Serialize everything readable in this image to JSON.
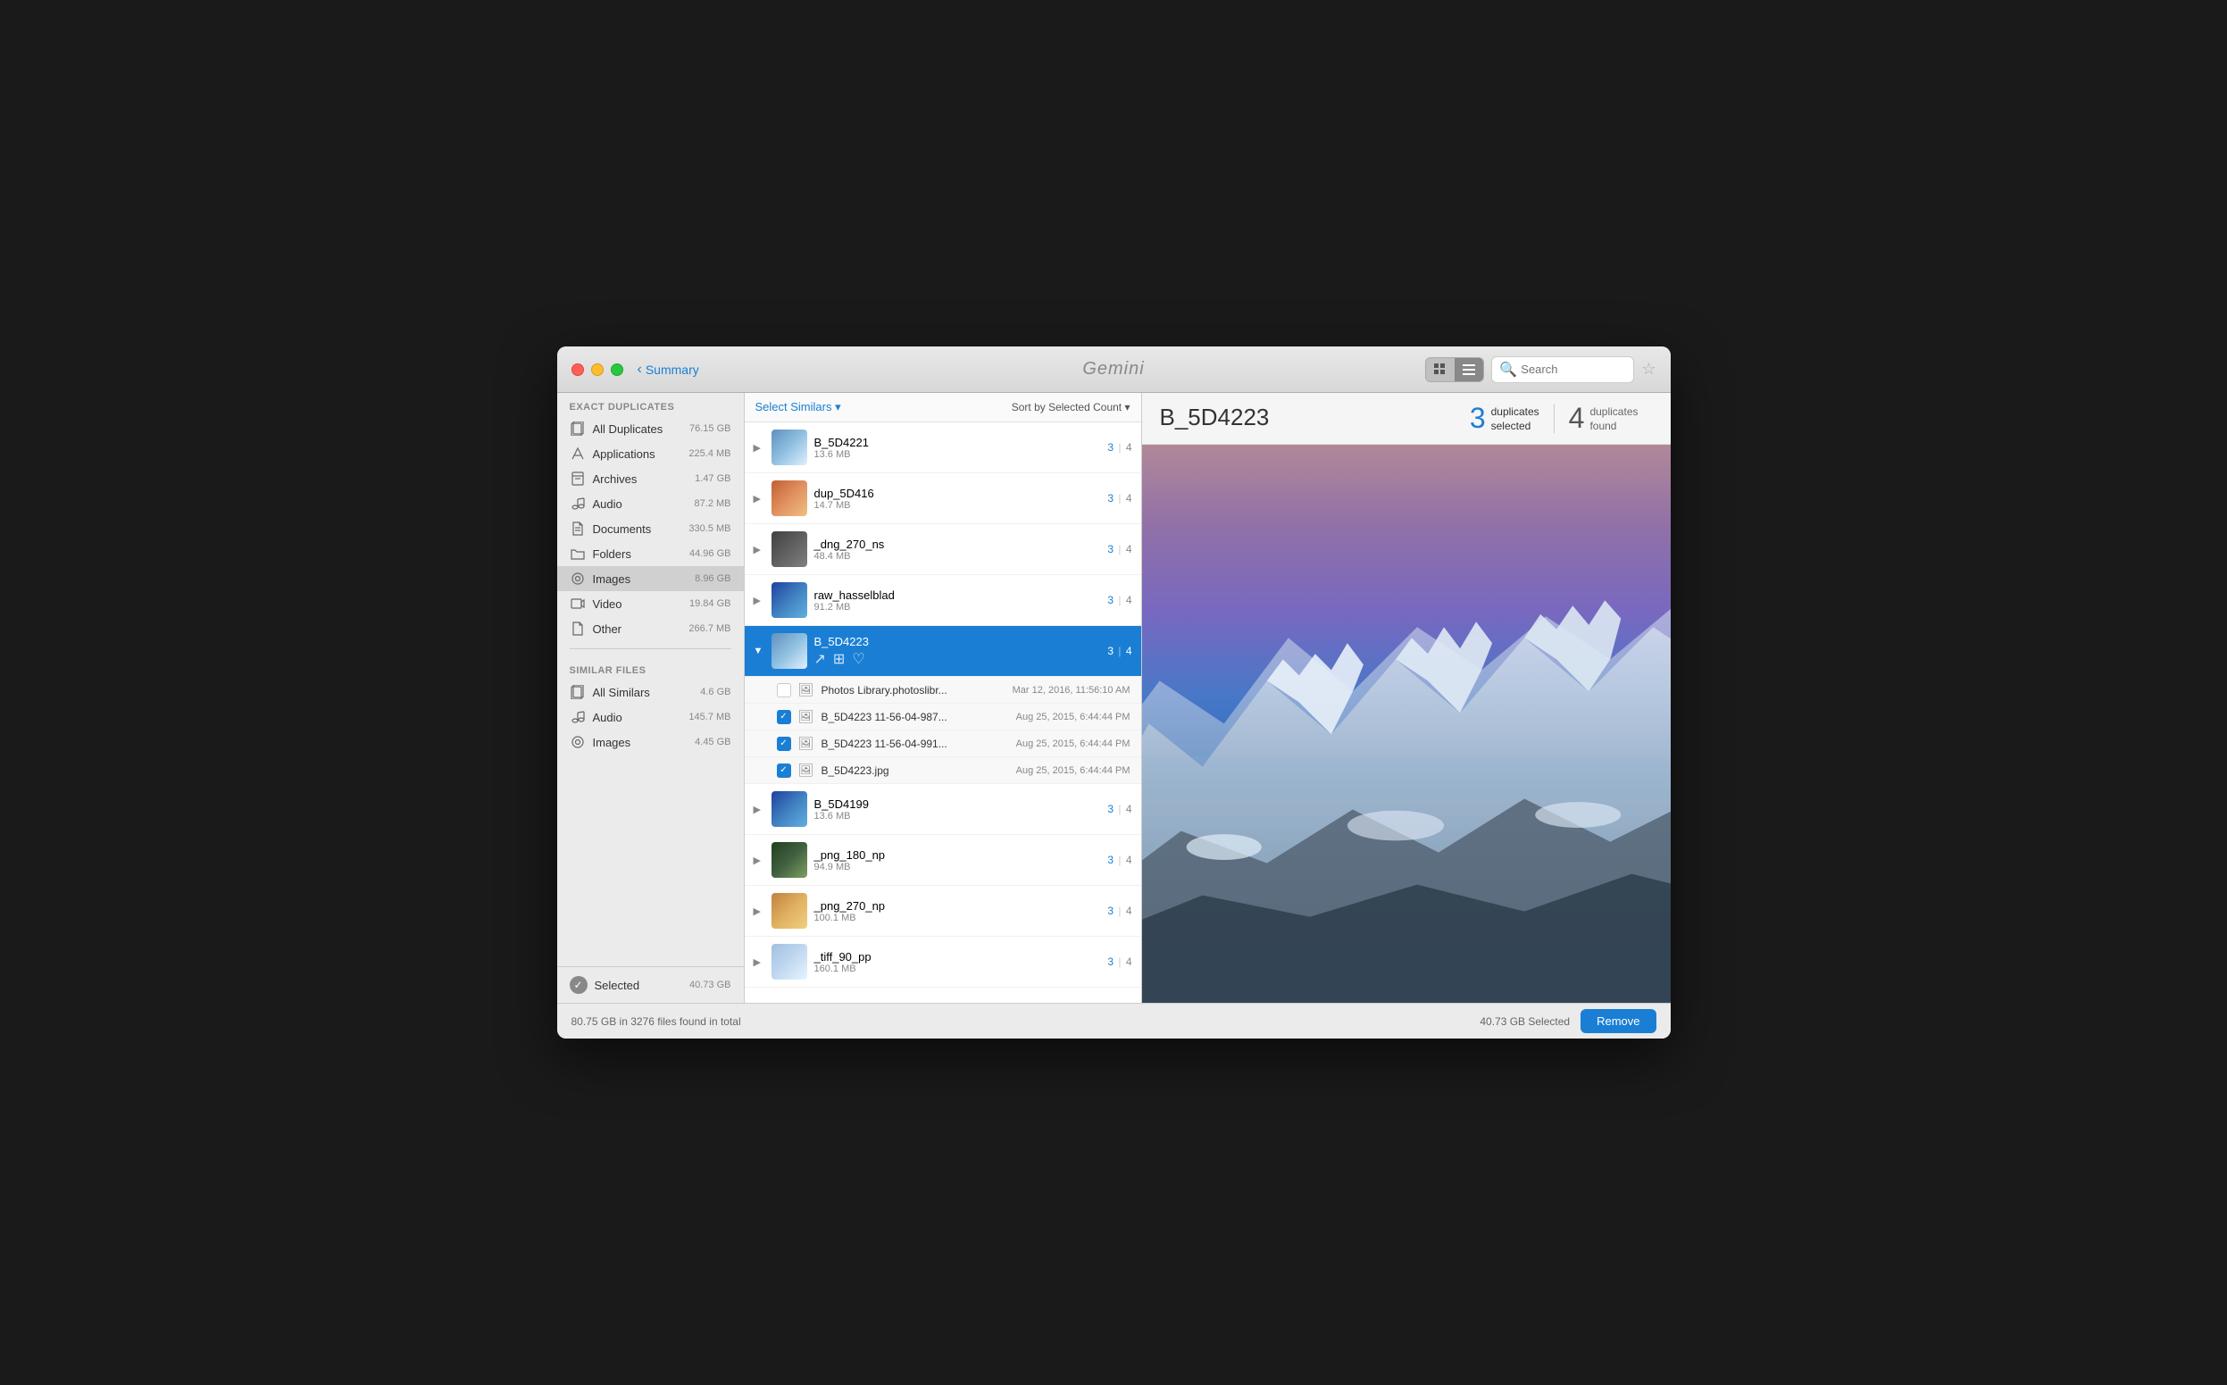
{
  "window": {
    "title": "Gemini"
  },
  "titlebar": {
    "back_label": "Summary",
    "search_placeholder": "Search",
    "view_grid_label": "⊞",
    "view_list_label": "≡"
  },
  "preview": {
    "title": "B_5D4223",
    "duplicates_selected_count": "3",
    "duplicates_selected_label": "duplicates\nselected",
    "duplicates_found_count": "4",
    "duplicates_found_label": "duplicates\nfound"
  },
  "sidebar": {
    "exact_duplicates_header": "Exact Duplicates",
    "items": [
      {
        "id": "all-duplicates",
        "label": "All Duplicates",
        "size": "76.15 GB",
        "icon": "📋"
      },
      {
        "id": "applications",
        "label": "Applications",
        "size": "225.4 MB",
        "icon": "🚀"
      },
      {
        "id": "archives",
        "label": "Archives",
        "size": "1.47 GB",
        "icon": "📦"
      },
      {
        "id": "audio",
        "label": "Audio",
        "size": "87.2 MB",
        "icon": "🎵"
      },
      {
        "id": "documents",
        "label": "Documents",
        "size": "330.5 MB",
        "icon": "📄"
      },
      {
        "id": "folders",
        "label": "Folders",
        "size": "44.96 GB",
        "icon": "📁"
      },
      {
        "id": "images",
        "label": "Images",
        "size": "8.96 GB",
        "icon": "📷"
      },
      {
        "id": "video",
        "label": "Video",
        "size": "19.84 GB",
        "icon": "🎬"
      },
      {
        "id": "other",
        "label": "Other",
        "size": "266.7 MB",
        "icon": "📎"
      }
    ],
    "similar_files_header": "Similar Files",
    "similar_items": [
      {
        "id": "all-similars",
        "label": "All Similars",
        "size": "4.6 GB",
        "icon": "📋"
      },
      {
        "id": "audio-similar",
        "label": "Audio",
        "size": "145.7 MB",
        "icon": "🎵"
      },
      {
        "id": "images-similar",
        "label": "Images",
        "size": "4.45 GB",
        "icon": "📷"
      }
    ],
    "selected_label": "Selected",
    "selected_size": "40.73 GB"
  },
  "file_list": {
    "select_similars_label": "Select Similars ▾",
    "sort_label": "Sort by Selected Count ▾",
    "groups": [
      {
        "id": "B_5D4221",
        "name": "B_5D4221",
        "size": "13.6 MB",
        "selected": "3",
        "found": "4",
        "expanded": false,
        "thumb_class": "thumb-mountains"
      },
      {
        "id": "dup_5D416",
        "name": "dup_5D416",
        "size": "14.7 MB",
        "selected": "3",
        "found": "4",
        "expanded": false,
        "thumb_class": "thumb-orange"
      },
      {
        "id": "_dng_270_ns",
        "name": "_dng_270_ns",
        "size": "48.4 MB",
        "selected": "3",
        "found": "4",
        "expanded": false,
        "thumb_class": "thumb-dark"
      },
      {
        "id": "raw_hasselblad",
        "name": "raw_hasselblad",
        "size": "91.2 MB",
        "selected": "3",
        "found": "4",
        "expanded": false,
        "thumb_class": "thumb-blue"
      },
      {
        "id": "B_5D4223",
        "name": "B_5D4223",
        "size": "",
        "selected": "3",
        "found": "4",
        "expanded": true,
        "thumb_class": "thumb-mountains",
        "sub_files": [
          {
            "id": "photos-library",
            "name": "Photos Library.photoslibr...",
            "date": "Mar 12, 2016, 11:56:10 AM",
            "checked": false,
            "icon": "🖼"
          },
          {
            "id": "b5d4223-1",
            "name": "B_5D4223 11-56-04-987...",
            "date": "Aug 25, 2015, 6:44:44 PM",
            "checked": true,
            "icon": "🖼"
          },
          {
            "id": "b5d4223-2",
            "name": "B_5D4223 11-56-04-991...",
            "date": "Aug 25, 2015, 6:44:44 PM",
            "checked": true,
            "icon": "🖼"
          },
          {
            "id": "b5d4223-jpg",
            "name": "B_5D4223.jpg",
            "date": "Aug 25, 2015, 6:44:44 PM",
            "checked": true,
            "icon": "🖼"
          }
        ]
      },
      {
        "id": "B_5D4199",
        "name": "B_5D4199",
        "size": "13.6 MB",
        "selected": "3",
        "found": "4",
        "expanded": false,
        "thumb_class": "thumb-blue"
      },
      {
        "id": "_png_180_np",
        "name": "_png_180_np",
        "size": "94.9 MB",
        "selected": "3",
        "found": "4",
        "expanded": false,
        "thumb_class": "thumb-forest"
      },
      {
        "id": "_png_270_np",
        "name": "_png_270_np",
        "size": "100.1 MB",
        "selected": "3",
        "found": "4",
        "expanded": false,
        "thumb_class": "thumb-desert"
      },
      {
        "id": "_tiff_90_pp",
        "name": "_tiff_90_pp",
        "size": "160.1 MB",
        "selected": "3",
        "found": "4",
        "expanded": false,
        "thumb_class": "thumb-snow"
      }
    ]
  },
  "bottom_bar": {
    "status_text": "80.75 GB in 3276 files found in total",
    "selected_size_text": "40.73 GB Selected",
    "remove_label": "Remove"
  }
}
